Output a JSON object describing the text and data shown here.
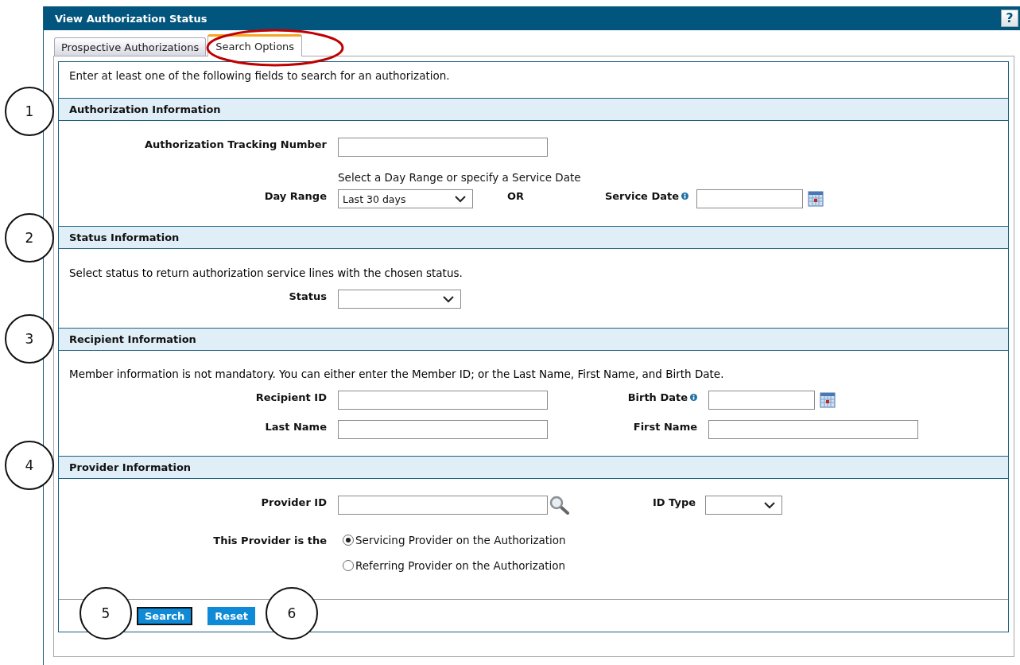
{
  "window": {
    "title": "View Authorization Status",
    "help": "?"
  },
  "tabs": [
    {
      "label": "Prospective Authorizations",
      "selected": false
    },
    {
      "label": "Search Options",
      "selected": true
    }
  ],
  "intro": "Enter at least one of the following fields to search for an authorization.",
  "sections": [
    {
      "title": "Authorization Information",
      "rows": [
        {
          "kind": "text-field",
          "label": "Authorization Tracking Number"
        },
        {
          "kind": "hint",
          "text": "Select a Day Range or specify a Service Date"
        },
        {
          "kind": "day-range",
          "label": "Day Range",
          "value": "Last 30 days",
          "or": "OR",
          "date_label": "Service Date"
        }
      ]
    },
    {
      "title": "Status Information",
      "note": "Select status to return authorization service lines with the chosen status.",
      "rows": [
        {
          "kind": "status",
          "label": "Status"
        }
      ]
    },
    {
      "title": "Recipient Information",
      "note": "Member information is not mandatory. You can either enter the Member ID; or the Last Name, First Name, and Birth Date.",
      "rows": [
        {
          "kind": "pair",
          "label": "Recipient ID",
          "second": {
            "kind": "date",
            "label": "Birth Date"
          }
        },
        {
          "kind": "pair",
          "label": "Last Name",
          "second": {
            "kind": "text",
            "label": "First Name"
          }
        }
      ]
    },
    {
      "title": "Provider Information",
      "rows": [
        {
          "kind": "provider-id",
          "label": "Provider ID",
          "second_label": "ID Type"
        },
        {
          "kind": "radio-group",
          "label": "This Provider is the",
          "options": [
            {
              "label": "Servicing Provider on the Authorization",
              "selected": true
            },
            {
              "label": "Referring Provider on the Authorization",
              "selected": false
            }
          ]
        }
      ]
    }
  ],
  "buttons": [
    {
      "label": "Search",
      "default": true
    },
    {
      "label": "Reset",
      "default": false
    }
  ],
  "callouts": [
    "1",
    "2",
    "3",
    "4",
    "5",
    "6"
  ]
}
